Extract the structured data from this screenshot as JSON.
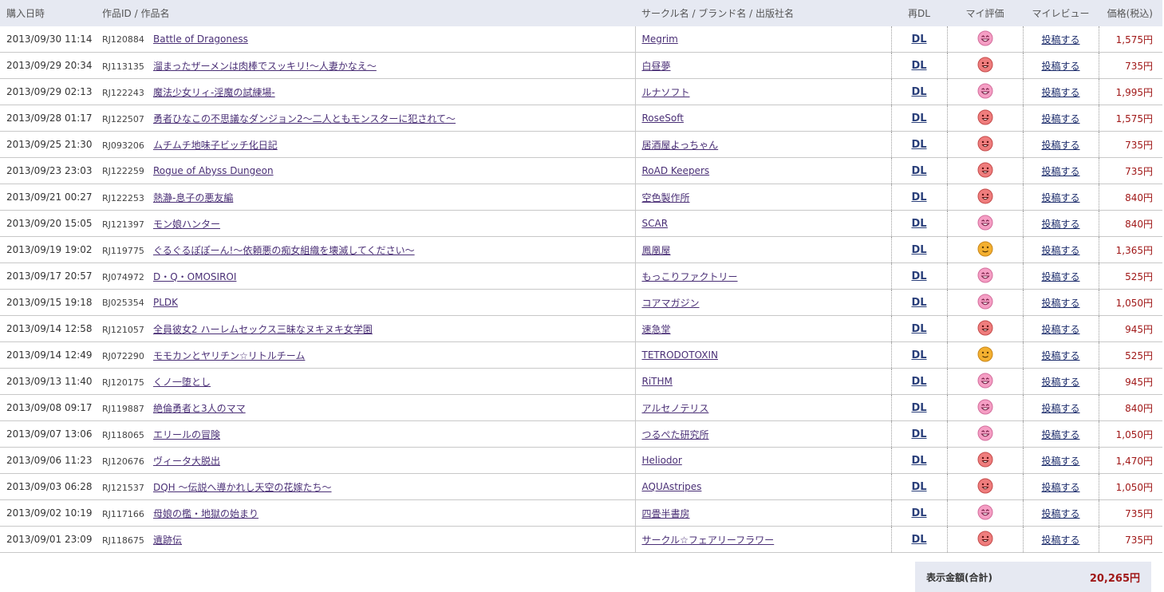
{
  "header": {
    "date": "購入日時",
    "work": "作品ID / 作品名",
    "circle": "サークル名 / ブランド名 / 出版社名",
    "redl": "再DL",
    "rating": "マイ評価",
    "review": "マイレビュー",
    "price": "価格(税込)"
  },
  "labels": {
    "dl": "DL",
    "review": "投稿する"
  },
  "colors": {
    "pink": "#f59ec4",
    "red": "#ef7d7d",
    "orange": "#f4b030",
    "header_bg": "#e6e9f2",
    "price": "#a01818"
  },
  "rows": [
    {
      "date": "2013/09/30 11:14",
      "id": "RJ120884",
      "title": "Battle of Dragoness",
      "circle": "Megrim",
      "rating": "pink-grin-face-icon",
      "price": "1,575円"
    },
    {
      "date": "2013/09/29 20:34",
      "id": "RJ113135",
      "title": "溜まったザーメンは肉棒でスッキリ!～人妻かなえ～",
      "circle": "白昼夢",
      "rating": "red-face-icon",
      "price": "735円"
    },
    {
      "date": "2013/09/29 02:13",
      "id": "RJ122243",
      "title": "魔法少女リィ-淫魔の試練場-",
      "circle": "ルナソフト",
      "rating": "pink-grin-face-icon",
      "price": "1,995円"
    },
    {
      "date": "2013/09/28 01:17",
      "id": "RJ122507",
      "title": "勇者ひなこの不思議なダンジョン2～二人ともモンスターに犯されて～",
      "circle": "RoseSoft",
      "rating": "red-face-icon",
      "price": "1,575円"
    },
    {
      "date": "2013/09/25 21:30",
      "id": "RJ093206",
      "title": "ムチムチ地味子ビッチ化日記",
      "circle": "居酒屋よっちゃん",
      "rating": "red-face-icon",
      "price": "735円"
    },
    {
      "date": "2013/09/23 23:03",
      "id": "RJ122259",
      "title": "Rogue of Abyss Dungeon",
      "circle": "RoAD Keepers",
      "rating": "red-face-icon",
      "price": "735円"
    },
    {
      "date": "2013/09/21 00:27",
      "id": "RJ122253",
      "title": "熱瀞-息子の悪友編",
      "circle": "空色製作所",
      "rating": "red-face-icon",
      "price": "840円"
    },
    {
      "date": "2013/09/20 15:05",
      "id": "RJ121397",
      "title": "モン娘ハンター",
      "circle": "SCAR",
      "rating": "pink-grin-face-icon",
      "price": "840円"
    },
    {
      "date": "2013/09/19 19:02",
      "id": "RJ119775",
      "title": "ぐるぐるぽぽーん!～依頼悪の痴女組織を壊滅してください～",
      "circle": "鳳凰屋",
      "rating": "orange-face-icon",
      "price": "1,365円"
    },
    {
      "date": "2013/09/17 20:57",
      "id": "RJ074972",
      "title": "D・Q・OMOSIROI",
      "circle": "もっこりファクトリー",
      "rating": "pink-grin-face-icon",
      "price": "525円"
    },
    {
      "date": "2013/09/15 19:18",
      "id": "BJ025354",
      "title": "PLDK",
      "circle": "コアマガジン",
      "rating": "pink-grin-face-icon",
      "price": "1,050円"
    },
    {
      "date": "2013/09/14 12:58",
      "id": "RJ121057",
      "title": "全員彼女2 ハーレムセックス三昧なヌキヌキ女学園",
      "circle": "速急堂",
      "rating": "red-face-icon",
      "price": "945円"
    },
    {
      "date": "2013/09/14 12:49",
      "id": "RJ072290",
      "title": "モモカンとヤリチン☆リトルチーム",
      "circle": "TETRODOTOXIN",
      "rating": "orange-face-icon",
      "price": "525円"
    },
    {
      "date": "2013/09/13 11:40",
      "id": "RJ120175",
      "title": "くノ一堕とし",
      "circle": "RiTHM",
      "rating": "pink-grin-face-icon",
      "price": "945円"
    },
    {
      "date": "2013/09/08 09:17",
      "id": "RJ119887",
      "title": "絶倫勇者と3人のママ",
      "circle": "アルセノテリス",
      "rating": "pink-grin-face-icon",
      "price": "840円"
    },
    {
      "date": "2013/09/07 13:06",
      "id": "RJ118065",
      "title": "エリールの冒険",
      "circle": "つるぺた研究所",
      "rating": "pink-grin-face-icon",
      "price": "1,050円"
    },
    {
      "date": "2013/09/06 11:23",
      "id": "RJ120676",
      "title": "ヴィータ大脱出",
      "circle": "Heliodor",
      "rating": "red-face-icon",
      "price": "1,470円"
    },
    {
      "date": "2013/09/03 06:28",
      "id": "RJ121537",
      "title": "DQH ～伝説へ導かれし天空の花嫁たち～",
      "circle": "AQUAstripes",
      "rating": "red-face-icon",
      "price": "1,050円"
    },
    {
      "date": "2013/09/02 10:19",
      "id": "RJ117166",
      "title": "母娘の檻・地獄の始まり",
      "circle": "四畳半書房",
      "rating": "pink-grin-face-icon",
      "price": "735円"
    },
    {
      "date": "2013/09/01 23:09",
      "id": "RJ118675",
      "title": "遺跡伝",
      "circle": "サークル☆フェアリーフラワー",
      "rating": "red-face-icon",
      "price": "735円"
    }
  ],
  "total": {
    "label": "表示金額(合計)",
    "amount": "20,265円"
  }
}
